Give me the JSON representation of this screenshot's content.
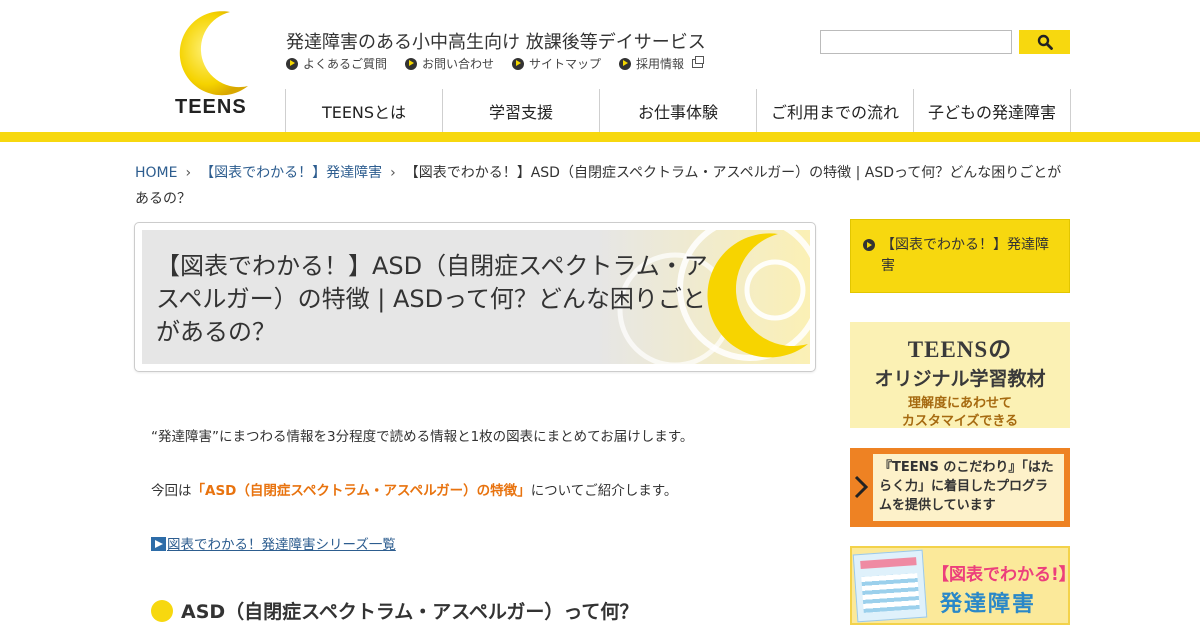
{
  "header": {
    "logo_text": "TEENS",
    "tagline": "発達障害のある小中高生向け 放課後等デイサービス",
    "sub_links": [
      {
        "label": "よくあるご質問"
      },
      {
        "label": "お問い合わせ"
      },
      {
        "label": "サイトマップ"
      },
      {
        "label": "採用情報"
      }
    ],
    "search": {
      "placeholder": "",
      "button_icon": "search-icon"
    }
  },
  "nav": {
    "items": [
      {
        "label": "TEENSとは"
      },
      {
        "label": "学習支援"
      },
      {
        "label": "お仕事体験"
      },
      {
        "label": "ご利用までの流れ"
      },
      {
        "label": "子どもの発達障害"
      }
    ]
  },
  "breadcrumb": {
    "home": "HOME",
    "category": "【図表でわかる！】発達障害",
    "current": "【図表でわかる！】ASD（自閉症スペクトラム・アスペルガー）の特徴 | ASDって何？どんな困りごとがあるの？"
  },
  "article": {
    "title": "【図表でわかる！】ASD（自閉症スペクトラム・アスペルガー）の特徴 | ASDって何？どんな困りごとがあるの？",
    "intro": "“発達障害”にまつわる情報を3分程度で読める情報と1枚の図表にまとめてお届けします。",
    "topic_prefix": "今回は",
    "topic_highlight": "「ASD（自閉症スペクトラム・アスペルガー）の特徴」",
    "topic_suffix": "についてご紹介します。",
    "series_link": "図表でわかる！発達障害シリーズ一覧",
    "section_heading": "ASD（自閉症スペクトラム・アスペルガー）って何？"
  },
  "sidebar": {
    "category": "【図表でわかる！】発達障害",
    "material_banner": {
      "line1": "TEENSの",
      "line2": "オリジナル学習教材",
      "line3": "理解度にあわせて",
      "line4": "カスタマイズできる"
    },
    "program_banner": {
      "text": "『TEENS のこだわり』「はたらく力」に着目したプログラムを提供しています"
    },
    "series_banner": {
      "line1": "【図表でわかる!】",
      "line2": "発達障害"
    }
  },
  "colors": {
    "brand_yellow": "#f7d80f",
    "link_blue": "#2d5d8f",
    "highlight_orange": "#e8730f",
    "banner_orange": "#ee8223"
  }
}
